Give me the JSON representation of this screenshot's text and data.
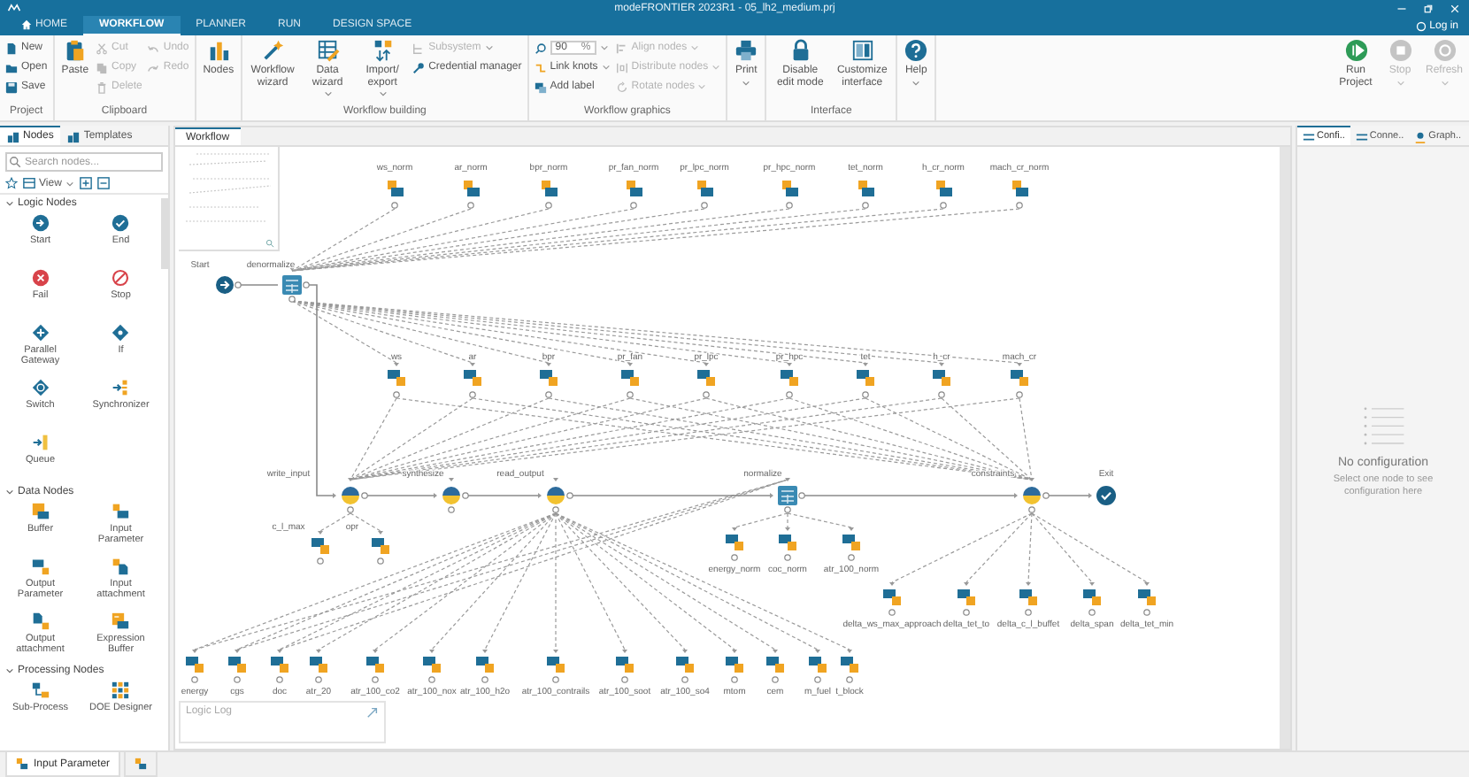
{
  "window": {
    "title": "modeFRONTIER 2023R1 - 05_lh2_medium.prj"
  },
  "menu_tabs": [
    {
      "label": "HOME",
      "selected": false
    },
    {
      "label": "WORKFLOW",
      "selected": true
    },
    {
      "label": "PLANNER",
      "selected": false
    },
    {
      "label": "RUN",
      "selected": false
    },
    {
      "label": "DESIGN SPACE",
      "selected": false
    }
  ],
  "login": "Log in",
  "ribbon": {
    "project": {
      "label": "Project",
      "buttons": [
        {
          "label": "New",
          "disabled": false
        },
        {
          "label": "Open",
          "disabled": false
        },
        {
          "label": "Save",
          "disabled": false
        }
      ]
    },
    "clipboard": {
      "label": "Clipboard",
      "paste": {
        "label": "Paste",
        "disabled": false
      },
      "edit": [
        {
          "label": "Cut",
          "disabled": true
        },
        {
          "label": "Copy",
          "disabled": true
        },
        {
          "label": "Delete",
          "disabled": true
        }
      ],
      "history": [
        {
          "label": "Undo",
          "disabled": true
        },
        {
          "label": "Redo",
          "disabled": true
        }
      ]
    },
    "nodes": {
      "label": "Nodes",
      "disabled": false
    },
    "building": {
      "label": "Workflow building",
      "large": [
        {
          "label": "Workflow wizard",
          "dropdown": false
        },
        {
          "label": "Data wizard",
          "dropdown": true
        },
        {
          "label": "Import/ export",
          "dropdown": true
        }
      ],
      "small": [
        {
          "label": "Subsystem",
          "disabled": true,
          "dropdown": true
        },
        {
          "label": "Credential manager",
          "disabled": false,
          "dropdown": false
        }
      ]
    },
    "graphics": {
      "label": "Workflow graphics",
      "zoom": "90",
      "zoom_unit": "%",
      "small": [
        {
          "label": "Link knots",
          "disabled": false,
          "dropdown": true
        },
        {
          "label": "Add label",
          "disabled": false,
          "dropdown": false
        }
      ],
      "arrange": [
        {
          "label": "Align nodes",
          "disabled": true,
          "dropdown": true
        },
        {
          "label": "Distribute nodes",
          "disabled": true,
          "dropdown": true
        },
        {
          "label": "Rotate nodes",
          "disabled": true,
          "dropdown": true
        }
      ]
    },
    "print": {
      "label": "Print",
      "dropdown": true
    },
    "interface": {
      "label": "Interface",
      "buttons": [
        {
          "label": "Disable edit mode"
        },
        {
          "label": "Customize interface"
        }
      ]
    },
    "help": {
      "label": "Help",
      "dropdown": true
    },
    "run": [
      {
        "label": "Run Project",
        "disabled": false,
        "dropdown": false
      },
      {
        "label": "Stop",
        "disabled": true,
        "dropdown": true
      },
      {
        "label": "Refresh",
        "disabled": true,
        "dropdown": true
      }
    ]
  },
  "left_panel": {
    "tabs": [
      {
        "label": "Nodes",
        "selected": true
      },
      {
        "label": "Templates",
        "selected": false
      }
    ],
    "search": {
      "placeholder": "Search nodes..."
    },
    "view_label": "View",
    "sections": [
      {
        "title": "Logic Nodes",
        "expanded": true,
        "items": [
          {
            "label": "Start"
          },
          {
            "label": "End"
          },
          {
            "label": "Fail"
          },
          {
            "label": "Stop"
          },
          {
            "label": "Parallel Gateway"
          },
          {
            "label": "If"
          },
          {
            "label": "Switch"
          },
          {
            "label": "Synchronizer"
          },
          {
            "label": "Queue"
          }
        ]
      },
      {
        "title": "Data Nodes",
        "expanded": true,
        "items": [
          {
            "label": "Buffer"
          },
          {
            "label": "Input Parameter"
          },
          {
            "label": "Output Parameter"
          },
          {
            "label": "Input attachment"
          },
          {
            "label": "Output attachment"
          },
          {
            "label": "Expression Buffer"
          }
        ]
      },
      {
        "title": "Processing Nodes",
        "expanded": true,
        "items": [
          {
            "label": "Sub-Process"
          },
          {
            "label": "DOE Designer"
          }
        ]
      }
    ]
  },
  "workflow": {
    "tab": "Workflow",
    "head": [
      {
        "kind": "start",
        "label": "Start"
      },
      {
        "kind": "calculator",
        "label": "denormalize"
      }
    ],
    "normalized_inputs": [
      "ws_norm",
      "ar_norm",
      "bpr_norm",
      "pr_fan_norm",
      "pr_lpc_norm",
      "pr_hpc_norm",
      "tet_norm",
      "h_cr_norm",
      "mach_cr_norm"
    ],
    "design_variables": [
      "ws",
      "ar",
      "bpr",
      "pr_fan",
      "pr_lpc",
      "pr_hpc",
      "tet",
      "h_cr",
      "mach_cr"
    ],
    "chain": [
      {
        "kind": "script",
        "label": "write_input"
      },
      {
        "kind": "script",
        "label": "synthesize"
      },
      {
        "kind": "script",
        "label": "read_output"
      },
      {
        "kind": "calculator",
        "label": "normalize"
      },
      {
        "kind": "script",
        "label": "constraints"
      },
      {
        "kind": "end",
        "label": "Exit"
      }
    ],
    "write_input_outputs": [
      "c_l_max",
      "opr"
    ],
    "normalize_outputs": [
      "energy_norm",
      "coc_norm",
      "atr_100_norm"
    ],
    "constraint_outputs": [
      "delta_ws_max_approach",
      "delta_tet_to",
      "delta_c_l_buffet",
      "delta_span",
      "delta_tet_min"
    ],
    "read_output_outputs": [
      "energy",
      "cgs",
      "doc",
      "atr_20",
      "atr_100_co2",
      "atr_100_nox",
      "atr_100_h2o",
      "atr_100_contrails",
      "atr_100_soot",
      "atr_100_so4",
      "mtom",
      "cem",
      "m_fuel",
      "t_block"
    ],
    "log_panel": "Logic Log"
  },
  "right_panel": {
    "tabs": [
      {
        "label": "Confi..",
        "selected": true
      },
      {
        "label": "Conne..",
        "selected": false
      },
      {
        "label": "Graph..",
        "selected": false
      }
    ],
    "empty_title": "No configuration",
    "empty_hint": "Select one node to see configuration here"
  },
  "bottom_tabs": [
    {
      "label": "Input Parameter",
      "selected": true
    },
    {
      "selected": false
    }
  ]
}
